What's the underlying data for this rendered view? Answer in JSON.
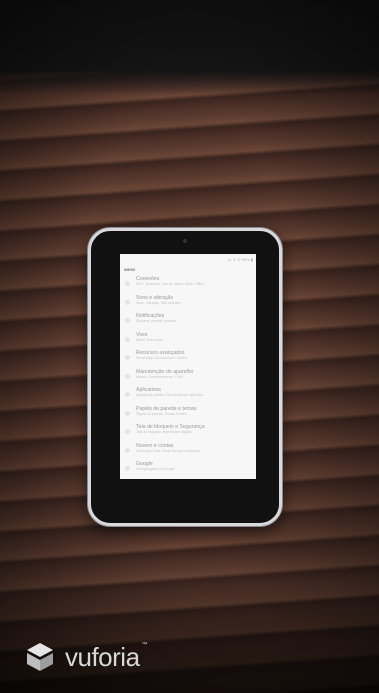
{
  "tablet_screen": {
    "status_text": "11 ⇧ ⊙ 99% ▮",
    "app_title": "amsc",
    "items": [
      {
        "title": "Conexões",
        "subtitle": "Wi-Fi, Bluetooth, Uso de dados, Modo Offline"
      },
      {
        "title": "Sons e vibração",
        "subtitle": "Sons, Vibração, Não perturbe"
      },
      {
        "title": "Notificações",
        "subtitle": "Bloquear, permitir, priorizar"
      },
      {
        "title": "Visor",
        "subtitle": "Brilho, Tela Inicial"
      },
      {
        "title": "Recursos avançados",
        "subtitle": "Smart Stay, Movimentos e Gestos"
      },
      {
        "title": "Manutenção do aparelho",
        "subtitle": "Bateria, Armazenamento, RAM"
      },
      {
        "title": "Aplicativos",
        "subtitle": "Aplicativos padrão, Permissões de aplicativo"
      },
      {
        "title": "Papéis de parede e temas",
        "subtitle": "Papéis de parede, Temas, Ícones"
      },
      {
        "title": "Tela de bloqueio e Segurança",
        "subtitle": "Tela de bloqueio, Impressões digitais"
      },
      {
        "title": "Nuvem e contas",
        "subtitle": "Samsung Cloud, Fazer backup e restaurar"
      },
      {
        "title": "Google",
        "subtitle": "Configurações do Google"
      }
    ]
  },
  "watermark": {
    "logo_icon": "vuforia-cube-icon",
    "brand": "vuforia",
    "trademark": "™"
  }
}
